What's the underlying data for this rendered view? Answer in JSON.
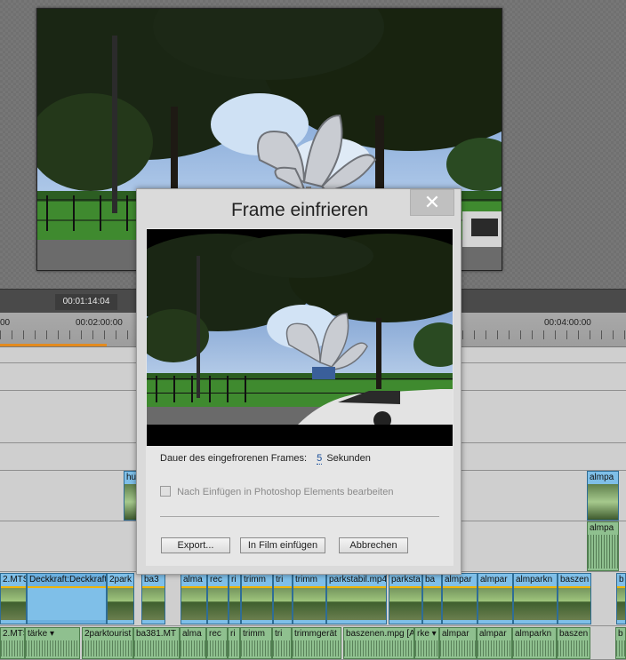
{
  "timeline": {
    "current_timecode": "00:01:14:04",
    "ruler_labels": [
      "00",
      "00:02:00:00",
      "00:04:00:00"
    ]
  },
  "dialog": {
    "title": "Frame einfrieren",
    "close_label": "✕",
    "duration_label": "Dauer des eingefrorenen Frames:",
    "duration_value": "5",
    "duration_unit": "Sekunden",
    "photoshop_checkbox_label": "Nach Einfügen in Photoshop Elements bearbeiten",
    "photoshop_checkbox_checked": false,
    "buttons": {
      "export": "Export...",
      "insert": "In Film einfügen",
      "cancel": "Abbrechen"
    }
  },
  "side_clips": {
    "track_left": "hu",
    "track_right_top": "almpa",
    "track_right_audio": "almpa"
  },
  "video_clips": [
    {
      "label": "2.MTS"
    },
    {
      "label": "Deckkraft:Deckkraft ▾"
    },
    {
      "label": "2park"
    },
    {
      "label": "ba3"
    },
    {
      "label": "alma"
    },
    {
      "label": "rec"
    },
    {
      "label": "ri"
    },
    {
      "label": "trimm"
    },
    {
      "label": "tri"
    },
    {
      "label": "trimm"
    },
    {
      "label": "parkstabil.mp4"
    },
    {
      "label": "parksta"
    },
    {
      "label": "ba"
    },
    {
      "label": "almpar"
    },
    {
      "label": "almpar"
    },
    {
      "label": "almparkn"
    },
    {
      "label": "baszen"
    },
    {
      "label": "b"
    }
  ],
  "audio_clips": [
    {
      "label": "2.MTS"
    },
    {
      "label": "tärke ▾"
    },
    {
      "label": "2parktourist"
    },
    {
      "label": "ba381.MT"
    },
    {
      "label": "alma"
    },
    {
      "label": "rec"
    },
    {
      "label": "ri"
    },
    {
      "label": "trimm"
    },
    {
      "label": "tri"
    },
    {
      "label": "trimmgerät"
    },
    {
      "label": "baszenen.mpg [A]"
    },
    {
      "label": "rke ▾"
    },
    {
      "label": "almpar"
    },
    {
      "label": "almpar"
    },
    {
      "label": "almparkn"
    },
    {
      "label": "baszen"
    },
    {
      "label": "b"
    }
  ]
}
